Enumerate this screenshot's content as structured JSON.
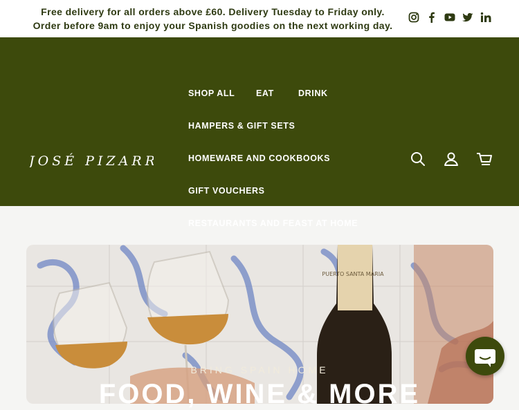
{
  "announcement": {
    "line1": "Free delivery for all orders above £60. Delivery Tuesday to Friday only.",
    "line2": "Order before 9am to enjoy your Spanish goodies on the next working day."
  },
  "social": [
    "instagram-icon",
    "facebook-icon",
    "youtube-icon",
    "twitter-icon",
    "linkedin-icon"
  ],
  "brand": {
    "logo_text": "JOSÉ PIZARRO"
  },
  "nav": {
    "items": [
      "SHOP ALL",
      "EAT",
      "DRINK",
      "HAMPERS & GIFT SETS",
      "HOMEWARE AND COOKBOOKS",
      "GIFT VOUCHERS",
      "RESTAURANTS AND FEAST AT HOME"
    ]
  },
  "header_icons": [
    "search-icon",
    "account-icon",
    "cart-icon"
  ],
  "hero": {
    "eyebrow": "BRING SPAIN HOME",
    "headline": "FOOD, WINE & MORE",
    "bottle_label": "PUERTO SANTA MARIA"
  },
  "colors": {
    "header_bg": "#3d4a0c",
    "announcement_text": "#2e3a12",
    "page_bg": "#f5f5f3"
  }
}
